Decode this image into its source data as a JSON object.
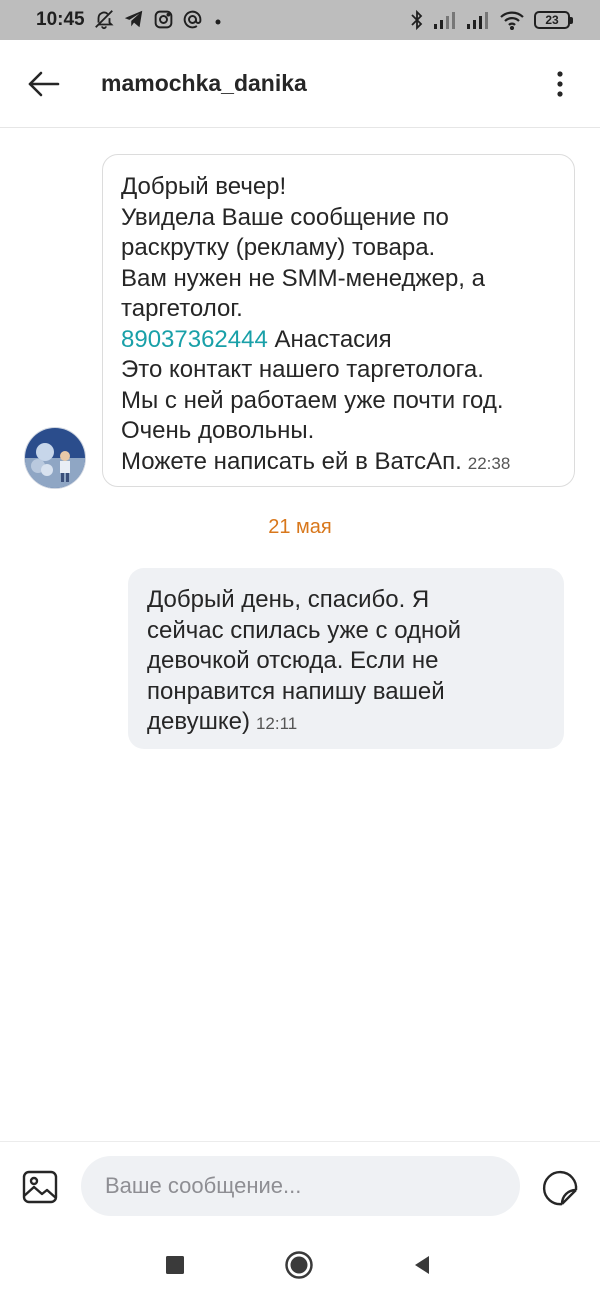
{
  "status_bar": {
    "time": "10:45",
    "battery": "23",
    "left_icons": [
      "muted-notifications-icon",
      "telegram-icon",
      "instagram-icon",
      "at-sign-icon",
      "dot-icon"
    ],
    "right_icons": [
      "bluetooth-icon",
      "signal-icon",
      "signal-icon",
      "wifi-icon",
      "battery-icon"
    ]
  },
  "header": {
    "title": "mamochka_danika",
    "back_icon": "arrow-left-icon",
    "more_icon": "more-vertical-icon"
  },
  "messages": [
    {
      "direction": "incoming",
      "lines": [
        "Добрый вечер!",
        "Увидела Ваше сообщение по",
        "раскрутку (рекламу) товара.",
        "Вам нужен не SMM-менеджер, а",
        "таргетолог."
      ],
      "phone": "89037362444",
      "phone_suffix": " Анастасия",
      "lines_after": [
        "Это контакт нашего таргетолога.",
        "Мы с ней работаем уже почти год.",
        "Очень довольны."
      ],
      "last_line": "Можете написать ей в ВатсАп.",
      "time": "22:38"
    },
    {
      "direction": "outgoing",
      "lines": [
        "Добрый день, спасибо. Я",
        "сейчас спилась уже с одной",
        "девочкой отсюда. Если не",
        "понравится напишу вашей"
      ],
      "last_line": "девушке)",
      "time": "12:11"
    }
  ],
  "date_separator": "21 мая",
  "composer": {
    "placeholder": "Ваше сообщение...",
    "value": "",
    "gallery_icon": "image-icon",
    "sticker_icon": "sticker-icon"
  },
  "nav": {
    "icons": [
      "square-icon",
      "home-circle-icon",
      "back-triangle-icon"
    ]
  },
  "colors": {
    "accent_link": "#19a0a8",
    "date_separator": "#d8771b",
    "outgoing_bubble": "#eff1f4",
    "status_bar": "#bdbdbd"
  }
}
